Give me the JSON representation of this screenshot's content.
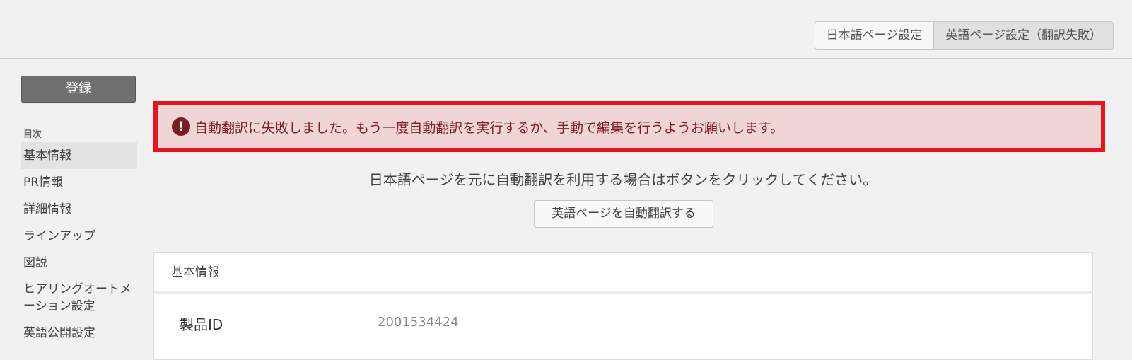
{
  "header": {
    "tabs": [
      {
        "label": "日本語ページ設定",
        "active": false
      },
      {
        "label": "英語ページ設定（翻訳失敗）",
        "active": true
      }
    ]
  },
  "sidebar": {
    "register_label": "登録",
    "toc_heading": "目次",
    "items": [
      {
        "label": "基本情報"
      },
      {
        "label": "PR情報"
      },
      {
        "label": "詳細情報"
      },
      {
        "label": "ラインアップ"
      },
      {
        "label": "図説"
      },
      {
        "label": "ヒアリングオートメーション設定"
      },
      {
        "label": "英語公開設定"
      }
    ]
  },
  "alert": {
    "icon": "exclamation-icon",
    "message": "自動翻訳に失敗しました。もう一度自動翻訳を実行するか、手動で編集を行うようお願いします。",
    "colors": {
      "border": "#e8141d",
      "background": "#f0d4d6",
      "text": "#7a2326"
    }
  },
  "main": {
    "instruction": "日本語ページを元に自動翻訳を利用する場合はボタンをクリックしてください。",
    "auto_translate_label": "英語ページを自動翻訳する",
    "panel": {
      "title": "基本情報",
      "fields": [
        {
          "label": "製品ID",
          "value": "2001534424"
        }
      ]
    }
  }
}
